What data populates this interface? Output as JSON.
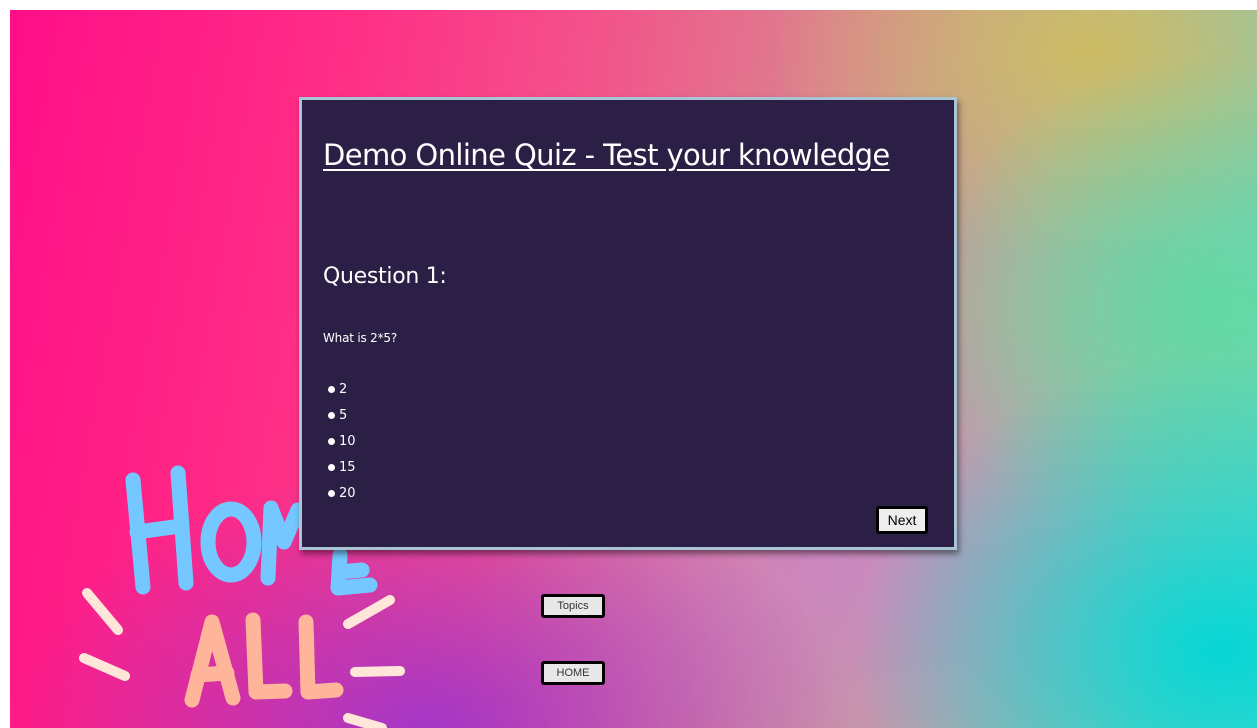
{
  "quiz": {
    "title": "Demo Online Quiz - Test your knowledge",
    "question_heading": "Question 1:",
    "question_text": "What is 2*5?",
    "options": [
      "2",
      "5",
      "10",
      "15",
      "20"
    ],
    "next_label": "Next"
  },
  "nav": {
    "topics_label": "Topics",
    "home_label": "HOME"
  },
  "decor": {
    "logo_text": "HOME ALL",
    "logo_top_color": "#74c8ff",
    "logo_bottom_color": "#ffb59a",
    "ray_color": "#ffe6d8"
  }
}
